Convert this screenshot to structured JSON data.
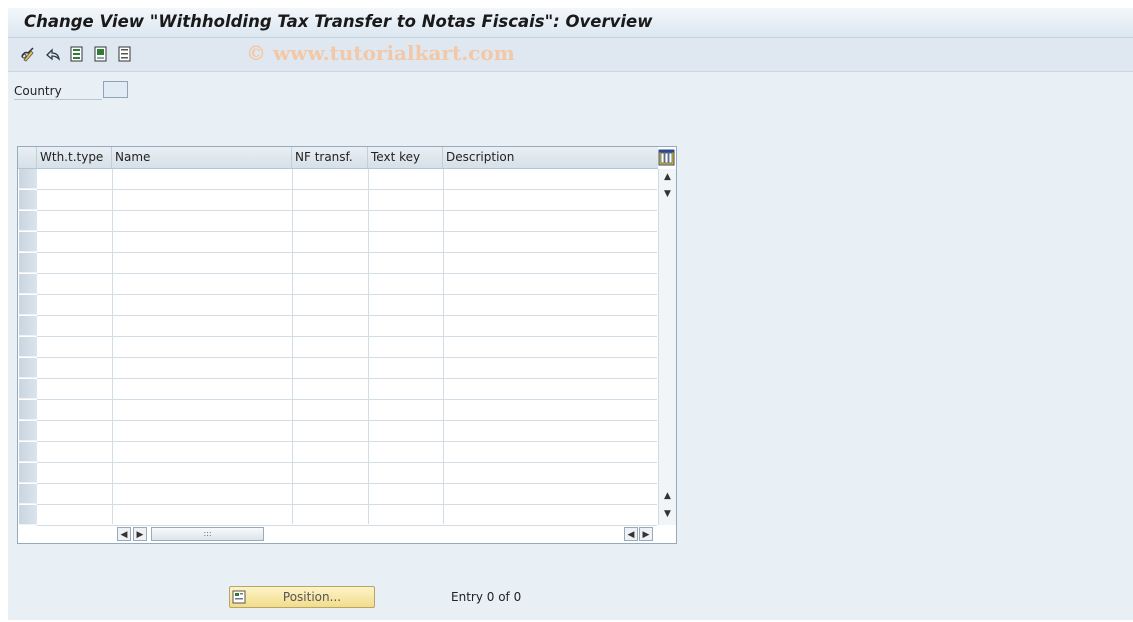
{
  "window": {
    "title": "Change View \"Withholding Tax Transfer to Notas Fiscais\": Overview"
  },
  "watermark": "© www.tutorialkart.com",
  "toolbar": {
    "items": [
      {
        "icon": "display-change-icon"
      },
      {
        "icon": "undo-icon"
      },
      {
        "icon": "select-all-icon"
      },
      {
        "icon": "select-block-icon"
      },
      {
        "icon": "deselect-all-icon"
      }
    ]
  },
  "form": {
    "country_label": "Country",
    "country_value": ""
  },
  "table": {
    "columns": [
      "Wth.t.type",
      "Name",
      "NF transf.",
      "Text key",
      "Description"
    ],
    "rows": []
  },
  "footer": {
    "position_label": "Position...",
    "entry_text": "Entry 0 of 0"
  },
  "colors": {
    "background": "#e8eff5",
    "position_button": "#f6e6a6"
  }
}
